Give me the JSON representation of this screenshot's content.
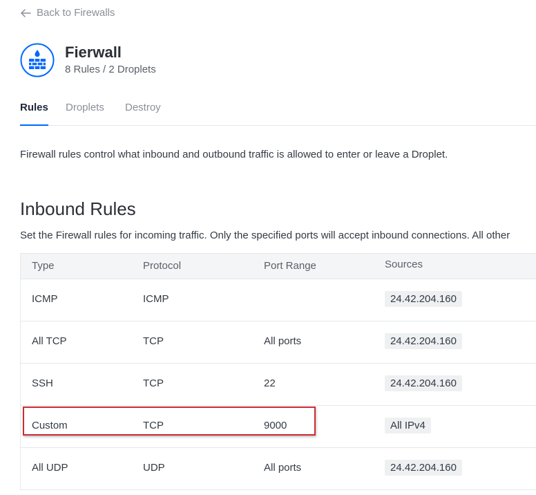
{
  "nav": {
    "back_label": "Back to Firewalls"
  },
  "firewall": {
    "name": "Fierwall",
    "meta": "8 Rules / 2 Droplets",
    "icon": "firewall-brick-icon"
  },
  "tabs": [
    {
      "label": "Rules",
      "active": true
    },
    {
      "label": "Droplets",
      "active": false
    },
    {
      "label": "Destroy",
      "active": false
    }
  ],
  "description": "Firewall rules control what inbound and outbound traffic is allowed to enter or leave a Droplet.",
  "inbound": {
    "title": "Inbound Rules",
    "subtitle": "Set the Firewall rules for incoming traffic. Only the specified ports will accept inbound connections. All other",
    "columns": [
      "Type",
      "Protocol",
      "Port Range",
      "Sources"
    ],
    "rows": [
      {
        "type": "ICMP",
        "protocol": "ICMP",
        "port_range": "",
        "source": "24.42.204.160"
      },
      {
        "type": "All TCP",
        "protocol": "TCP",
        "port_range": "All ports",
        "source": "24.42.204.160"
      },
      {
        "type": "SSH",
        "protocol": "TCP",
        "port_range": "22",
        "source": "24.42.204.160"
      },
      {
        "type": "Custom",
        "protocol": "TCP",
        "port_range": "9000",
        "source": "All IPv4"
      },
      {
        "type": "All UDP",
        "protocol": "UDP",
        "port_range": "All ports",
        "source": "24.42.204.160"
      }
    ]
  },
  "colors": {
    "accent": "#0069ff",
    "highlight": "#cc2b2f",
    "header_bg": "#f3f5f7",
    "chip_bg": "#eef0f2"
  }
}
